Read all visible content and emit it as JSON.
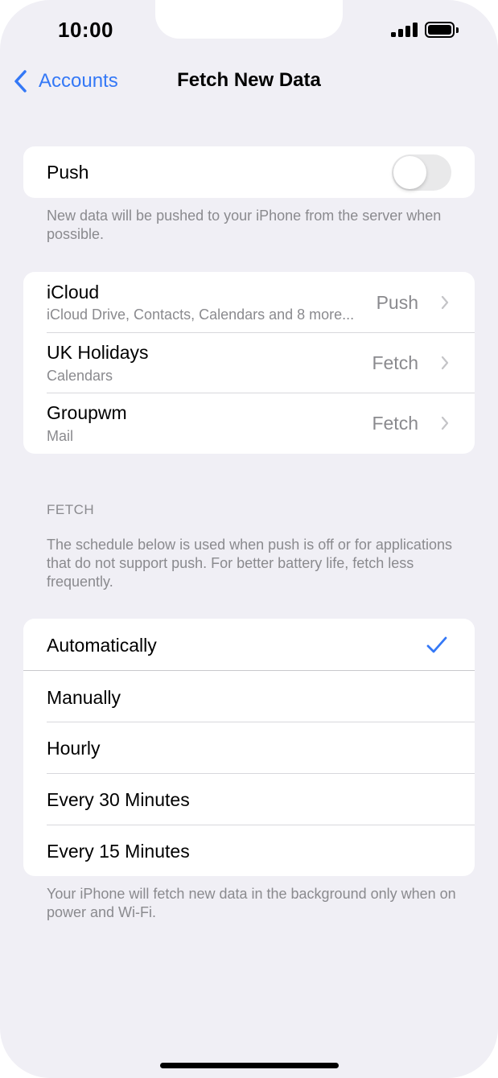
{
  "status_bar": {
    "time": "10:00"
  },
  "nav": {
    "back_label": "Accounts",
    "title": "Fetch New Data"
  },
  "push": {
    "label": "Push",
    "enabled": false,
    "note": "New data will be pushed to your iPhone from the server when possible."
  },
  "accounts": [
    {
      "name": "iCloud",
      "detail": "iCloud Drive, Contacts, Calendars and 8 more...",
      "mode": "Push"
    },
    {
      "name": "UK Holidays",
      "detail": "Calendars",
      "mode": "Fetch"
    },
    {
      "name": "Groupwm",
      "detail": "Mail",
      "mode": "Fetch"
    }
  ],
  "fetch": {
    "header": "FETCH",
    "description": "The schedule below is used when push is off or for applications that do not support push. For better battery life, fetch less frequently.",
    "options": [
      "Automatically",
      "Manually",
      "Hourly",
      "Every 30 Minutes",
      "Every 15 Minutes"
    ],
    "selected": "Automatically",
    "footer": "Your iPhone will fetch new data in the background only when on power and Wi-Fi."
  },
  "colors": {
    "accent": "#3478f6",
    "background": "#f0eff5",
    "secondary_text": "#8a8a8e"
  }
}
